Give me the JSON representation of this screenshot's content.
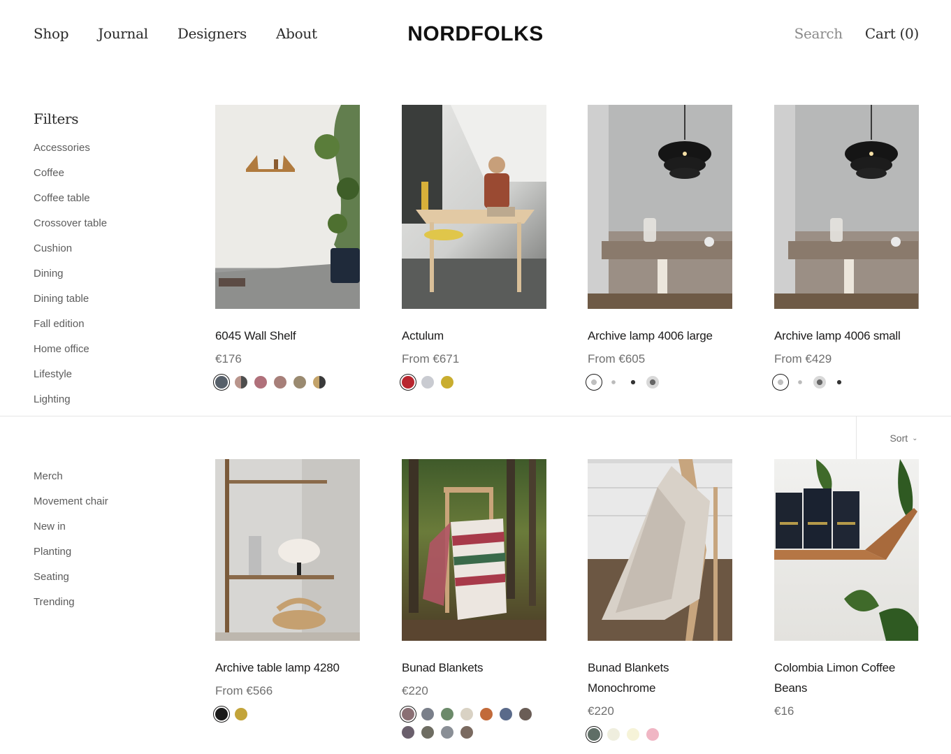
{
  "header": {
    "nav_left": [
      "Shop",
      "Journal",
      "Designers",
      "About"
    ],
    "logo": "NORDFOLKS",
    "search": "Search",
    "cart": "Cart (0)"
  },
  "filters": {
    "title": "Filters",
    "items_top": [
      "Accessories",
      "Coffee",
      "Coffee table",
      "Crossover table",
      "Cushion",
      "Dining",
      "Dining table",
      "Fall edition",
      "Home office",
      "Lifestyle",
      "Lighting"
    ],
    "items_bottom": [
      "Merch",
      "Movement chair",
      "New in",
      "Planting",
      "Seating",
      "Trending"
    ]
  },
  "sort": {
    "label": "Sort"
  },
  "products": [
    {
      "title": "6045 Wall Shelf",
      "price": "€176"
    },
    {
      "title": "Actulum",
      "price": "From €671"
    },
    {
      "title": "Archive lamp 4006 large",
      "price": "From €605"
    },
    {
      "title": "Archive lamp 4006 small",
      "price": "From €429"
    },
    {
      "title": "Archive table lamp 4280",
      "price": "From €566"
    },
    {
      "title": "Bunad Blankets",
      "price": "€220"
    },
    {
      "title": "Bunad Blankets Monochrome",
      "price": "€220"
    },
    {
      "title": "Colombia Limon Coffee Beans",
      "price": "€16"
    }
  ],
  "colors": {
    "text": "#1c1b1b",
    "muted": "#6f6f6f",
    "border": "#e5e5e5"
  }
}
